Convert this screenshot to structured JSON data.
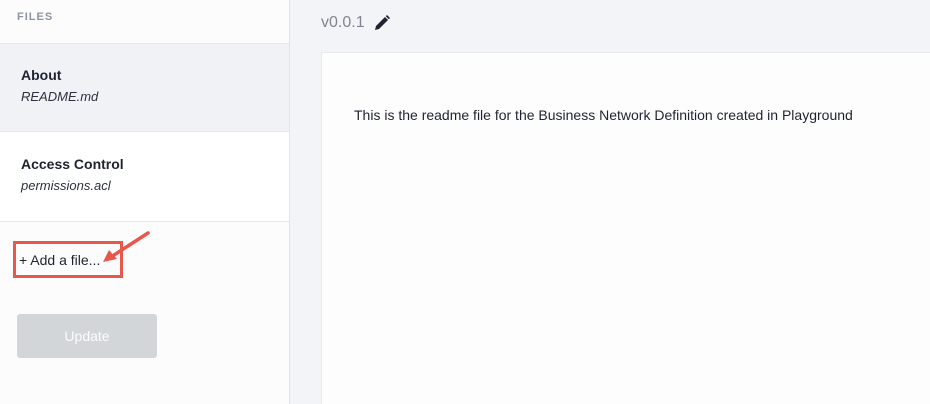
{
  "sidebar": {
    "header": "FILES",
    "files": [
      {
        "title": "About",
        "filename": "README.md"
      },
      {
        "title": "Access Control",
        "filename": "permissions.acl"
      }
    ],
    "add_file_label": "+ Add a file...",
    "update_label": "Update"
  },
  "main": {
    "version": "v0.0.1",
    "readme_text": "This is the readme file for the Business Network Definition created in Playground"
  },
  "colors": {
    "highlight_box": "#e8574c",
    "update_button_disabled": "#d3d6d9"
  }
}
